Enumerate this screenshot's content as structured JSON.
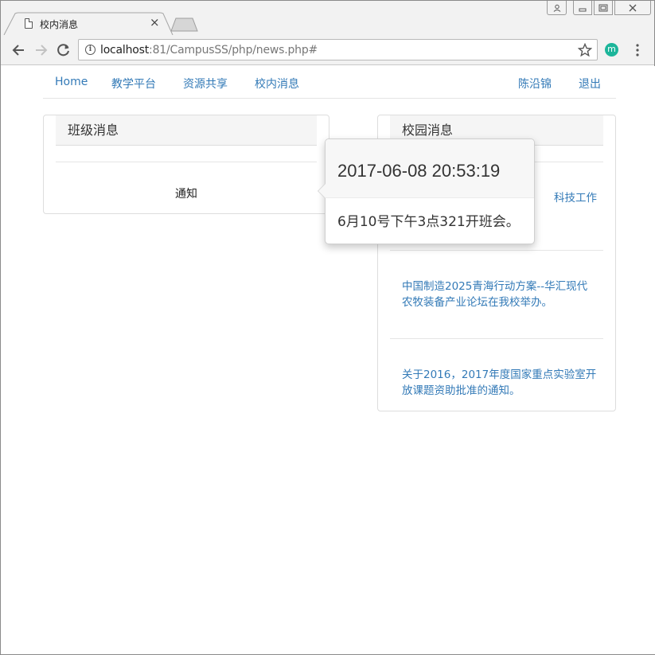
{
  "browser": {
    "tab_title": "校内消息",
    "tab_close": "×",
    "url_host": "localhost",
    "url_rest": ":81/CampusSS/php/news.php#",
    "extension_letter": "m"
  },
  "navbar": {
    "left_links": [
      "Home",
      "教学平台",
      "资源共享",
      "校内消息"
    ],
    "right_links": [
      "陈沿锦",
      "退出"
    ]
  },
  "class_panel": {
    "heading": "班级消息",
    "items": [
      "通知"
    ]
  },
  "campus_panel": {
    "heading": "校园消息",
    "items": [
      "科技工作",
      "中国制造2025青海行动方案--华汇现代农牧装备产业论坛在我校举办。",
      "关于2016，2017年度国家重点实验室开放课题资助批准的通知。"
    ]
  },
  "popover": {
    "title": "2017-06-08 20:53:19",
    "content": "6月10号下午3点321开班会。"
  },
  "colors": {
    "link": "#337ab7",
    "panel_heading_bg": "#f5f5f5",
    "border": "#dddddd"
  }
}
